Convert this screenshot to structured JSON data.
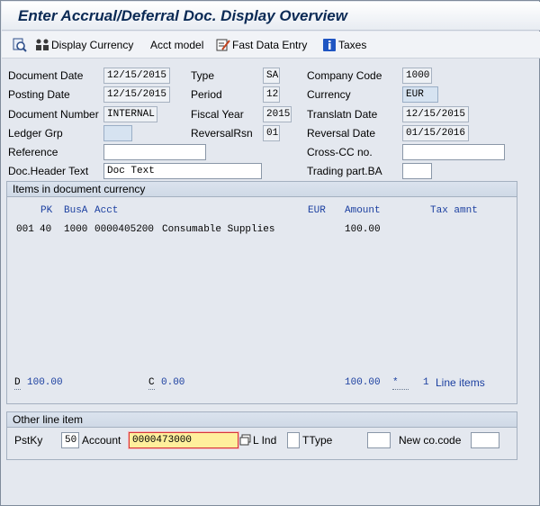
{
  "window": {
    "title": "Enter Accrual/Deferral Doc. Display Overview"
  },
  "toolbar": {
    "display_currency": "Display Currency",
    "acct_model": "Acct model",
    "fast_data_entry": "Fast Data Entry",
    "taxes": "Taxes"
  },
  "header": {
    "document_date_label": "Document Date",
    "document_date": "12/15/2015",
    "posting_date_label": "Posting Date",
    "posting_date": "12/15/2015",
    "document_number_label": "Document Number",
    "document_number": "INTERNAL",
    "ledger_grp_label": "Ledger Grp",
    "ledger_grp": "",
    "reference_label": "Reference",
    "reference": "",
    "doc_header_text_label": "Doc.Header Text",
    "doc_header_text": "Doc Text",
    "type_label": "Type",
    "type": "SA",
    "period_label": "Period",
    "period": "12",
    "fiscal_year_label": "Fiscal Year",
    "fiscal_year": "2015",
    "reversal_rsn_label": "ReversalRsn",
    "reversal_rsn": "01",
    "company_code_label": "Company Code",
    "company_code": "1000",
    "currency_label": "Currency",
    "currency": "EUR",
    "translatn_date_label": "Translatn Date",
    "translatn_date": "12/15/2015",
    "reversal_date_label": "Reversal Date",
    "reversal_date": "01/15/2016",
    "cross_cc_label": "Cross-CC no.",
    "cross_cc": "",
    "trading_part_label": "Trading part.BA",
    "trading_part": ""
  },
  "items": {
    "group_title": "Items in document currency",
    "columns": {
      "pk": "PK",
      "busa": "BusA",
      "acct": "Acct",
      "eur": "EUR",
      "amount": "Amount",
      "tax": "Tax amnt"
    },
    "rows": [
      {
        "no": "001",
        "pk": "40",
        "busa": "1000",
        "acct": "0000405200",
        "text": "Consumable Supplies",
        "amount": "100.00"
      }
    ],
    "footer": {
      "d_label": "D",
      "d_value": "100.00",
      "c_label": "C",
      "c_value": "0.00",
      "total": "100.00",
      "star": "*",
      "line_count": "1",
      "line_items_label": "Line items"
    }
  },
  "other": {
    "group_title": "Other line item",
    "pstky_label": "PstKy",
    "pstky": "50",
    "account_label": "Account",
    "account": "0000473000",
    "lind_label": "L Ind",
    "lind": "",
    "ttype_label": "TType",
    "ttype": "",
    "new_cocode_label": "New co.code",
    "new_cocode": ""
  }
}
